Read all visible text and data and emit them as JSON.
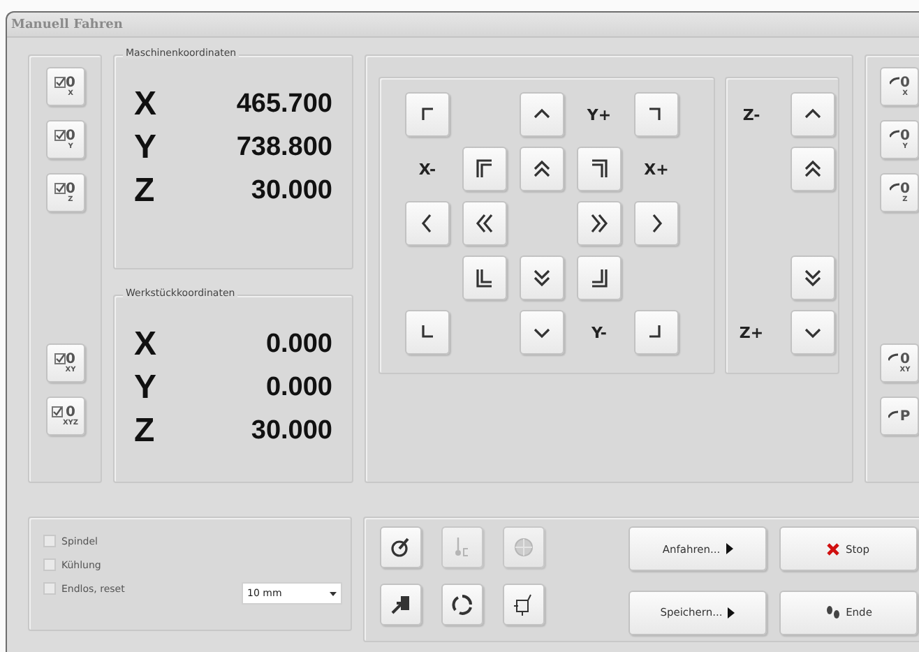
{
  "window": {
    "title": "Manuell Fahren"
  },
  "zero_buttons": [
    {
      "digit": "0",
      "axis": "X"
    },
    {
      "digit": "0",
      "axis": "Y"
    },
    {
      "digit": "0",
      "axis": "Z"
    },
    {
      "digit": "0",
      "axis": "XY"
    },
    {
      "digit": "0",
      "axis": "XYZ"
    }
  ],
  "machine_coordinates": {
    "title": "Maschinenkoordinaten",
    "rows": [
      {
        "axis": "X",
        "value": "465.700"
      },
      {
        "axis": "Y",
        "value": "738.800"
      },
      {
        "axis": "Z",
        "value": "30.000"
      }
    ]
  },
  "workpiece_coordinates": {
    "title": "Werkstückkoordinaten",
    "rows": [
      {
        "axis": "X",
        "value": "0.000"
      },
      {
        "axis": "Y",
        "value": "0.000"
      },
      {
        "axis": "Z",
        "value": "30.000"
      }
    ]
  },
  "jog_xy": [
    [
      {
        "kind": "corner-nw"
      },
      {
        "kind": "blank"
      },
      {
        "kind": "up"
      },
      {
        "kind": "label",
        "text": "Y+"
      },
      {
        "kind": "corner-ne"
      }
    ],
    [
      {
        "kind": "label",
        "text": "X-"
      },
      {
        "kind": "corner2-nw"
      },
      {
        "kind": "up2"
      },
      {
        "kind": "corner2-ne"
      },
      {
        "kind": "label",
        "text": "X+"
      }
    ],
    [
      {
        "kind": "left"
      },
      {
        "kind": "left2"
      },
      {
        "kind": "blank"
      },
      {
        "kind": "right2"
      },
      {
        "kind": "right"
      }
    ],
    [
      {
        "kind": "blank"
      },
      {
        "kind": "corner2-sw"
      },
      {
        "kind": "down2"
      },
      {
        "kind": "corner2-se"
      },
      {
        "kind": "blank"
      }
    ],
    [
      {
        "kind": "corner-sw"
      },
      {
        "kind": "blank"
      },
      {
        "kind": "down"
      },
      {
        "kind": "label",
        "text": "Y-"
      },
      {
        "kind": "corner-se"
      }
    ]
  ],
  "jog_z": [
    [
      {
        "kind": "label",
        "text": "Z-"
      },
      {
        "kind": "up"
      }
    ],
    [
      {
        "kind": "blank"
      },
      {
        "kind": "up2"
      }
    ],
    [
      {
        "kind": "blank"
      },
      {
        "kind": "blank"
      }
    ],
    [
      {
        "kind": "blank"
      },
      {
        "kind": "down2"
      }
    ],
    [
      {
        "kind": "label",
        "text": "Z+"
      },
      {
        "kind": "down"
      }
    ]
  ],
  "goto_buttons": [
    {
      "text": "0",
      "axis": "X"
    },
    {
      "text": "0",
      "axis": "Y"
    },
    {
      "text": "0",
      "axis": "Z"
    },
    {
      "text": "0",
      "axis": "XY"
    },
    {
      "text": "P"
    }
  ],
  "options": [
    {
      "label": "Spindel",
      "checked": false
    },
    {
      "label": "Kühlung",
      "checked": false
    },
    {
      "label": "Endlos, reset",
      "checked": false
    }
  ],
  "step_select": {
    "value": "10 mm"
  },
  "tool_buttons": [
    {
      "kind": "probe",
      "disabled": false
    },
    {
      "kind": "tool-length",
      "disabled": true
    },
    {
      "kind": "disc",
      "disabled": true
    },
    {
      "kind": "home",
      "disabled": false
    },
    {
      "kind": "cycle",
      "disabled": false
    },
    {
      "kind": "frame",
      "disabled": false
    }
  ],
  "action_buttons": [
    {
      "label": "Anfahren...",
      "kind": "menu"
    },
    {
      "label": "Stop",
      "kind": "stop"
    },
    {
      "label": "Speichern...",
      "kind": "menu"
    },
    {
      "label": "Ende",
      "kind": "exit"
    }
  ]
}
